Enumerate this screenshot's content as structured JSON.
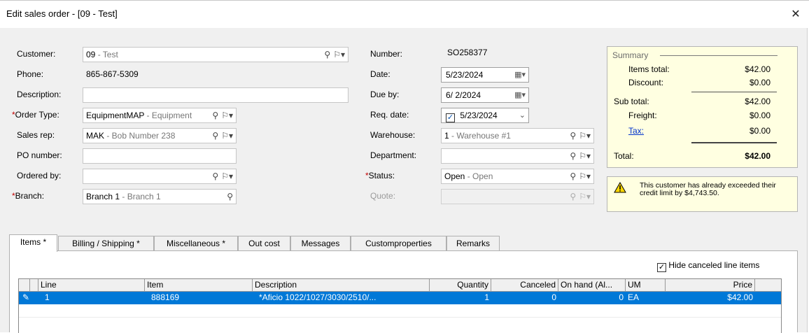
{
  "window": {
    "title": "Edit sales order - [09 - Test]"
  },
  "left": {
    "customer": {
      "label": "Customer:",
      "code": "09",
      "desc": " - Test"
    },
    "phone": {
      "label": "Phone:",
      "value": "865-867-5309"
    },
    "description": {
      "label": "Description:",
      "value": ""
    },
    "order_type": {
      "label": "Order Type:",
      "code": "EquipmentMAP",
      "desc": " - Equipment"
    },
    "sales_rep": {
      "label": "Sales rep:",
      "code": "MAK",
      "desc": " - Bob Number 238"
    },
    "po_number": {
      "label": "PO number:",
      "value": ""
    },
    "ordered_by": {
      "label": "Ordered by:",
      "value": ""
    },
    "branch": {
      "label": "Branch:",
      "code": "Branch 1",
      "desc": " - Branch 1"
    }
  },
  "middle": {
    "number": {
      "label": "Number:",
      "value": "SO258377"
    },
    "date": {
      "label": "Date:",
      "value": "5/23/2024"
    },
    "due_by": {
      "label": "Due by:",
      "value": "6/ 2/2024"
    },
    "req_date": {
      "label": "Req. date:",
      "value": "5/23/2024"
    },
    "warehouse": {
      "label": "Warehouse:",
      "code": "1",
      "desc": " - Warehouse #1"
    },
    "department": {
      "label": "Department:",
      "value": ""
    },
    "status": {
      "label": "Status:",
      "code": "Open",
      "desc": " - Open"
    },
    "quote": {
      "label": "Quote:",
      "value": ""
    }
  },
  "summary": {
    "legend": "Summary",
    "items_total_label": "Items total:",
    "items_total": "$42.00",
    "discount_label": "Discount:",
    "discount": "$0.00",
    "sub_total_label": "Sub total:",
    "sub_total": "$42.00",
    "freight_label": "Freight:",
    "freight": "$0.00",
    "tax_label": "Tax:",
    "tax": "$0.00",
    "total_label": "Total:",
    "total": "$42.00"
  },
  "warning": {
    "text": "This customer has already exceeded their credit limit by $4,743.50."
  },
  "tabs": [
    {
      "label": "Items *"
    },
    {
      "label": "Billing / Shipping  *"
    },
    {
      "label": "Miscellaneous *"
    },
    {
      "label": "Out cost"
    },
    {
      "label": "Messages"
    },
    {
      "label": "Customproperties"
    },
    {
      "label": "Remarks"
    }
  ],
  "items": {
    "hide_canceled_label": "Hide canceled line items",
    "columns": [
      "Line",
      "Item",
      "Description",
      "Quantity",
      "Canceled",
      "On hand (Al...",
      "UM",
      "Price"
    ],
    "rows": [
      {
        "line": "1",
        "item": "888169",
        "description": "*Aficio 1022/1027/3030/2510/...",
        "quantity": "1",
        "canceled": "0",
        "on_hand": "0",
        "um": "EA",
        "price": "$42.00"
      }
    ]
  },
  "colors": {
    "selection": "#0078d7",
    "summary_bg": "#ffffe1",
    "required": "#c00000",
    "link": "#0033cc"
  }
}
